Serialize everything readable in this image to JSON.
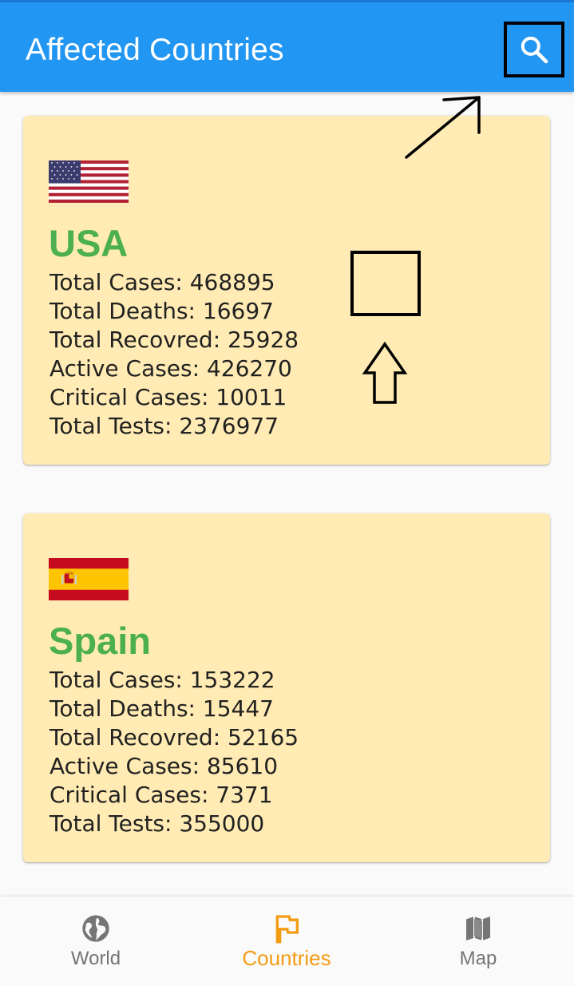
{
  "appbar": {
    "title": "Affected Countries",
    "search_icon": "search-icon",
    "color": "#2196f3"
  },
  "countries": [
    {
      "name": "USA",
      "flag": "usa-flag",
      "stats": [
        {
          "label": "Total Cases: 468895"
        },
        {
          "label": "Total Deaths: 16697"
        },
        {
          "label": "Total Recovred: 25928"
        },
        {
          "label": "Active Cases: 426270"
        },
        {
          "label": "Critical Cases: 10011"
        },
        {
          "label": "Total Tests: 2376977"
        }
      ]
    },
    {
      "name": "Spain",
      "flag": "spain-flag",
      "stats": [
        {
          "label": "Total Cases: 153222"
        },
        {
          "label": "Total Deaths: 15447"
        },
        {
          "label": "Total Recovred: 52165"
        },
        {
          "label": "Active Cases: 85610"
        },
        {
          "label": "Critical Cases: 7371"
        },
        {
          "label": "Total Tests: 355000"
        }
      ]
    }
  ],
  "bottom_nav": {
    "items": [
      {
        "label": "World",
        "icon": "globe-icon",
        "active": false
      },
      {
        "label": "Countries",
        "icon": "flag-icon",
        "active": true
      },
      {
        "label": "Map",
        "icon": "map-icon",
        "active": false
      }
    ],
    "active_color": "#f39c12",
    "inactive_color": "#757575"
  },
  "colors": {
    "card_background": "#ffebb3",
    "country_name": "#4caf50"
  }
}
